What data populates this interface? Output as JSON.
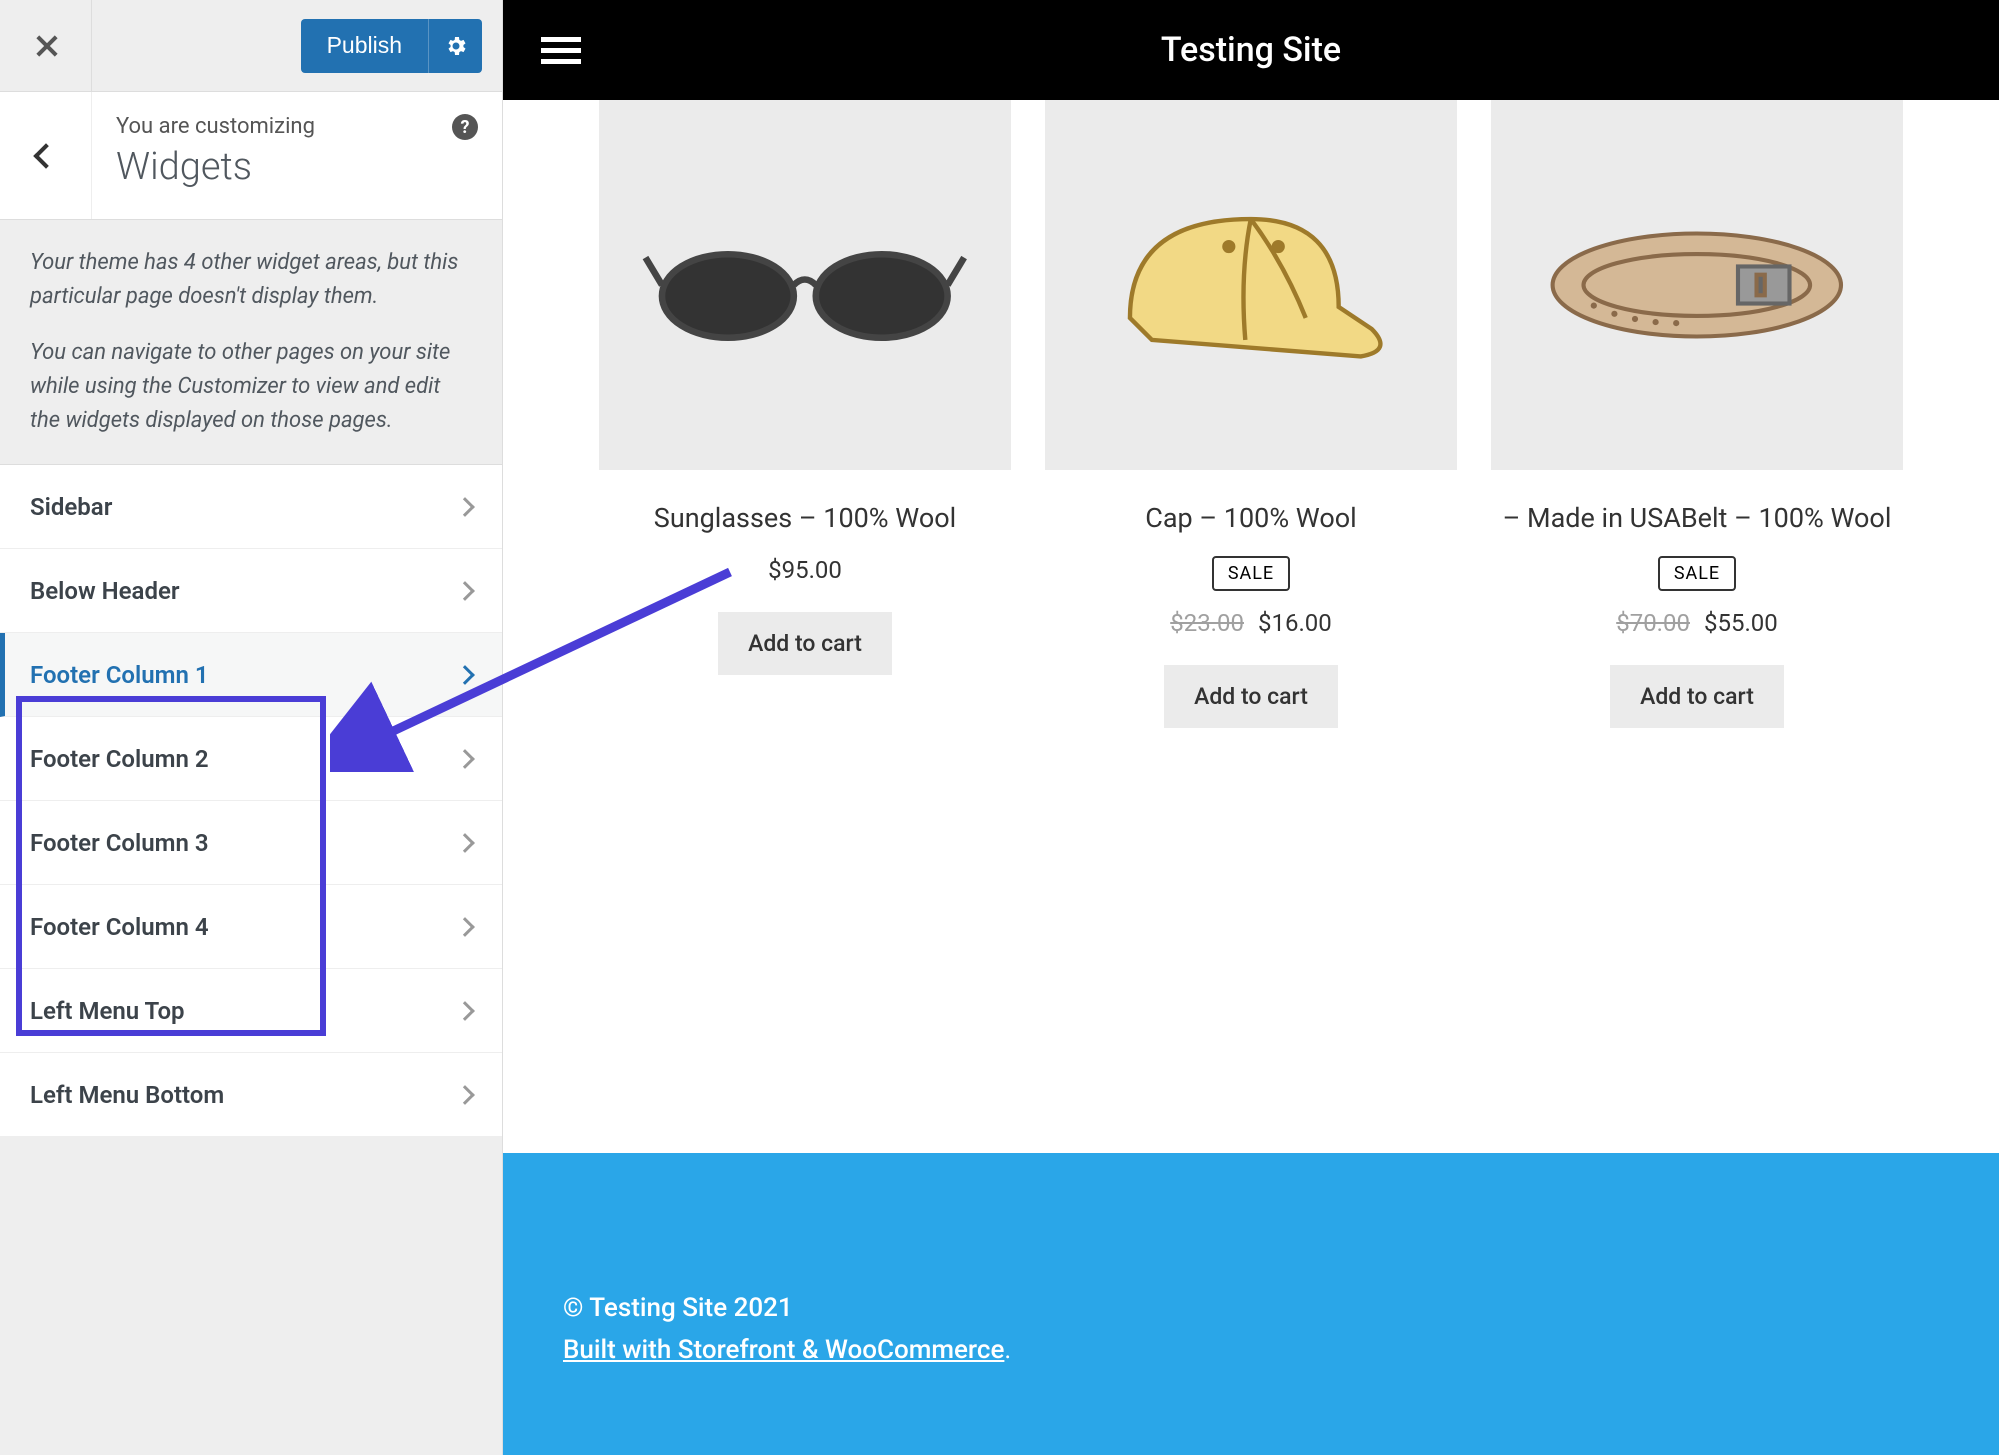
{
  "customizer": {
    "publish_label": "Publish",
    "header_small": "You are customizing",
    "header_title": "Widgets",
    "desc1": "Your theme has 4 other widget areas, but this particular page doesn't display them.",
    "desc2": "You can navigate to other pages on your site while using the Customizer to view and edit the widgets displayed on those pages.",
    "items": [
      {
        "label": "Sidebar",
        "active": false
      },
      {
        "label": "Below Header",
        "active": false
      },
      {
        "label": "Footer Column 1",
        "active": true
      },
      {
        "label": "Footer Column 2",
        "active": false
      },
      {
        "label": "Footer Column 3",
        "active": false
      },
      {
        "label": "Footer Column 4",
        "active": false
      },
      {
        "label": "Left Menu Top",
        "active": false
      },
      {
        "label": "Left Menu Bottom",
        "active": false
      }
    ]
  },
  "site": {
    "title": "Testing Site",
    "footer_copy": "© Testing Site 2021",
    "footer_built": "Built with Storefront & WooCommerce",
    "footer_dot": "."
  },
  "products": [
    {
      "title": "Sunglasses – 100% Wool",
      "sale": false,
      "old_price": "",
      "price": "$95.00",
      "button": "Add to cart",
      "icon": "sunglasses"
    },
    {
      "title": "Cap – 100% Wool",
      "sale": true,
      "sale_label": "SALE",
      "old_price": "$23.00",
      "price": "$16.00",
      "button": "Add to cart",
      "icon": "cap"
    },
    {
      "title": "– Made in USABelt – 100% Wool",
      "sale": true,
      "sale_label": "SALE",
      "old_price": "$70.00",
      "price": "$55.00",
      "button": "Add to cart",
      "icon": "belt"
    }
  ]
}
